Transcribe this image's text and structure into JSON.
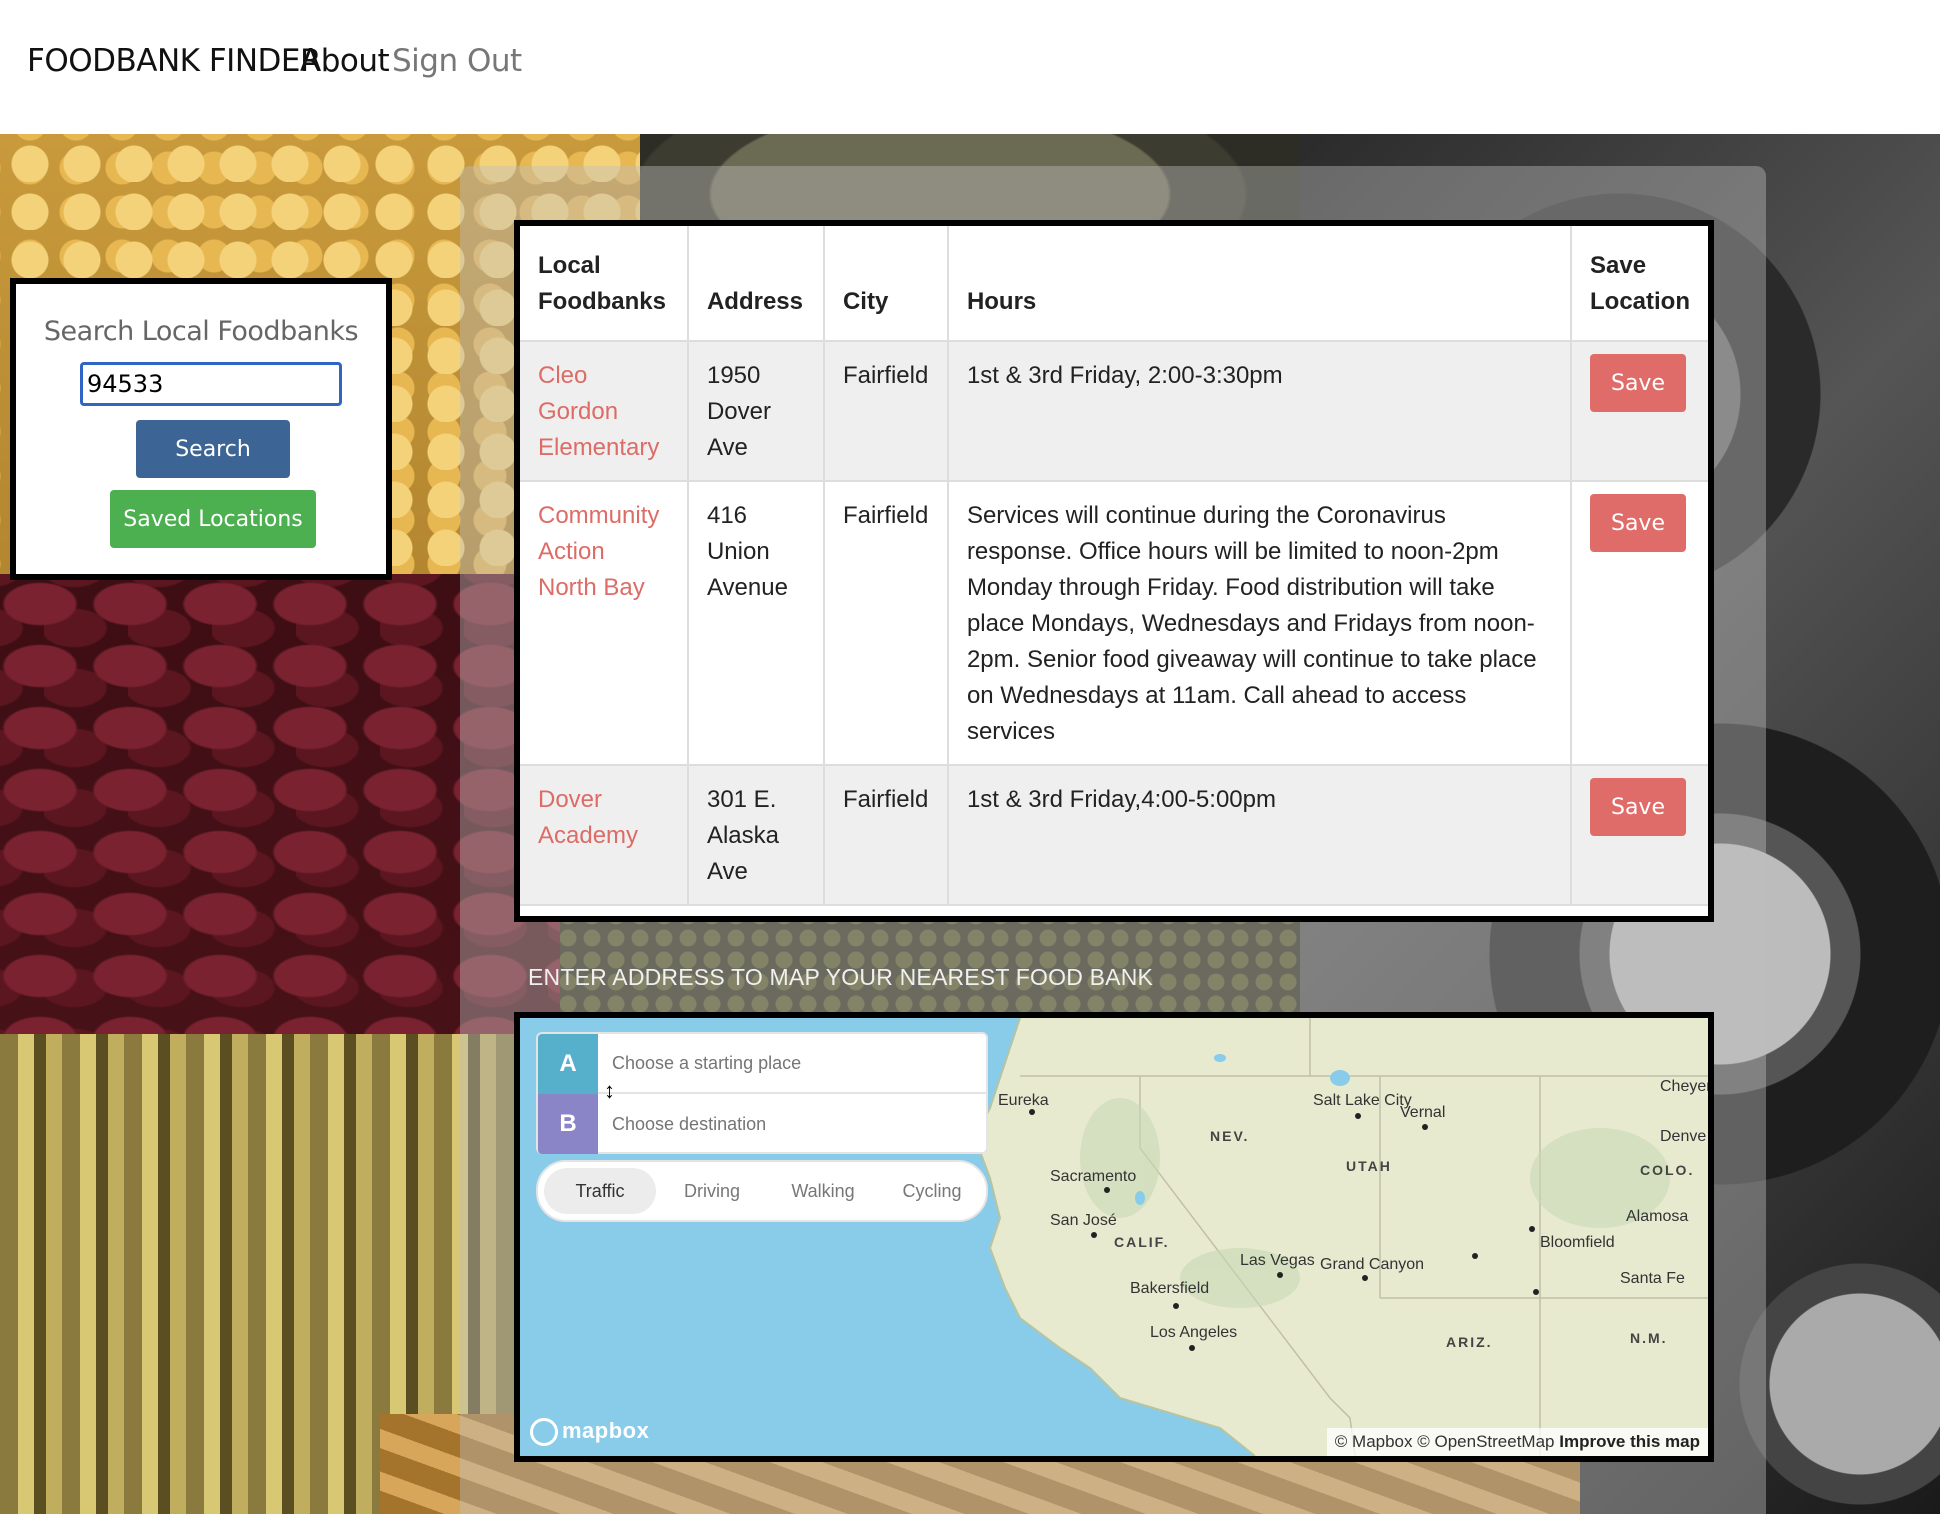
{
  "nav": {
    "brand": "FOODBANK FINDER",
    "about": "About",
    "sign_out": "Sign Out"
  },
  "search": {
    "title": "Search Local Foodbanks",
    "value": "94533",
    "search_label": "Search",
    "saved_label": "Saved Locations"
  },
  "table": {
    "headers": [
      "Local Foodbanks",
      "Address",
      "City",
      "Hours",
      "Save Location"
    ],
    "rows": [
      {
        "name": "Cleo Gordon Elementary",
        "address": "1950 Dover Ave",
        "city": "Fairfield",
        "hours": "1st & 3rd Friday, 2:00-3:30pm",
        "save": "Save"
      },
      {
        "name": "Community Action North Bay",
        "address": "416 Union Avenue",
        "city": "Fairfield",
        "hours": "Services will continue during the Coronavirus response. Office hours will be limited to noon-2pm Monday through Friday. Food distribution will take place Mondays, Wednesdays and Fridays from noon-2pm. Senior food giveaway will continue to take place on Wednesdays at 11am. Call ahead to access services",
        "save": "Save"
      },
      {
        "name": "Dover Academy",
        "address": "301 E. Alaska Ave",
        "city": "Fairfield",
        "hours": "1st & 3rd Friday,4:00-5:00pm",
        "save": "Save"
      }
    ]
  },
  "map": {
    "heading": "ENTER ADDRESS TO MAP YOUR NEAREST FOOD BANK",
    "directions": {
      "a_label": "A",
      "b_label": "B",
      "start_placeholder": "Choose a starting place",
      "dest_placeholder": "Choose destination"
    },
    "modes": [
      "Traffic",
      "Driving",
      "Walking",
      "Cycling"
    ],
    "active_mode": "Traffic",
    "places": [
      "Eureka",
      "Salt Lake City",
      "Vernal",
      "Cheyer",
      "NEV.",
      "Denve",
      "UTAH",
      "COLO.",
      "Sacramento",
      "San José",
      "CALIF.",
      "Alamosa",
      "Bloomfield",
      "Las Vegas",
      "Grand Canyon",
      "Bakersfield",
      "Santa Fe",
      "Los Angeles",
      "ARIZ.",
      "N.M."
    ],
    "logo": "mapbox",
    "attribution": "© Mapbox © OpenStreetMap",
    "improve": "Improve this map"
  },
  "colors": {
    "search_btn": "#3c6596",
    "saved_btn": "#4caf50",
    "save_btn": "#e06c69",
    "link": "#dd6b66",
    "input_focus": "#2f66c4"
  }
}
